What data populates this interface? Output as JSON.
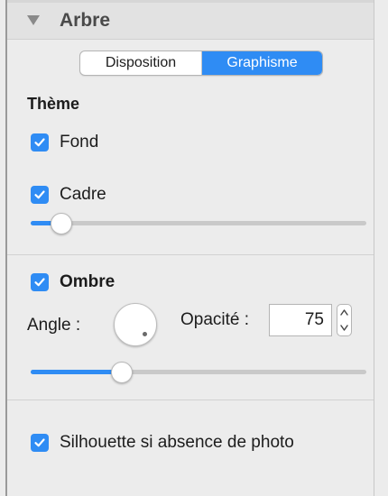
{
  "panel": {
    "title": "Arbre",
    "tabs": [
      {
        "label": "Disposition",
        "selected": false
      },
      {
        "label": "Graphisme",
        "selected": true
      }
    ]
  },
  "theme": {
    "heading": "Thème",
    "fond": {
      "label": "Fond",
      "checked": true
    },
    "cadre": {
      "label": "Cadre",
      "checked": true,
      "slider_value": 0.09
    }
  },
  "shadow": {
    "label": "Ombre",
    "checked": true,
    "angle_label": "Angle :",
    "opacity_label": "Opacité :",
    "opacity_value": "75",
    "slider_value": 0.27
  },
  "silhouette": {
    "label": "Silhouette si absence de photo",
    "checked": true
  },
  "colors": {
    "accent": "#2f8cf4"
  }
}
